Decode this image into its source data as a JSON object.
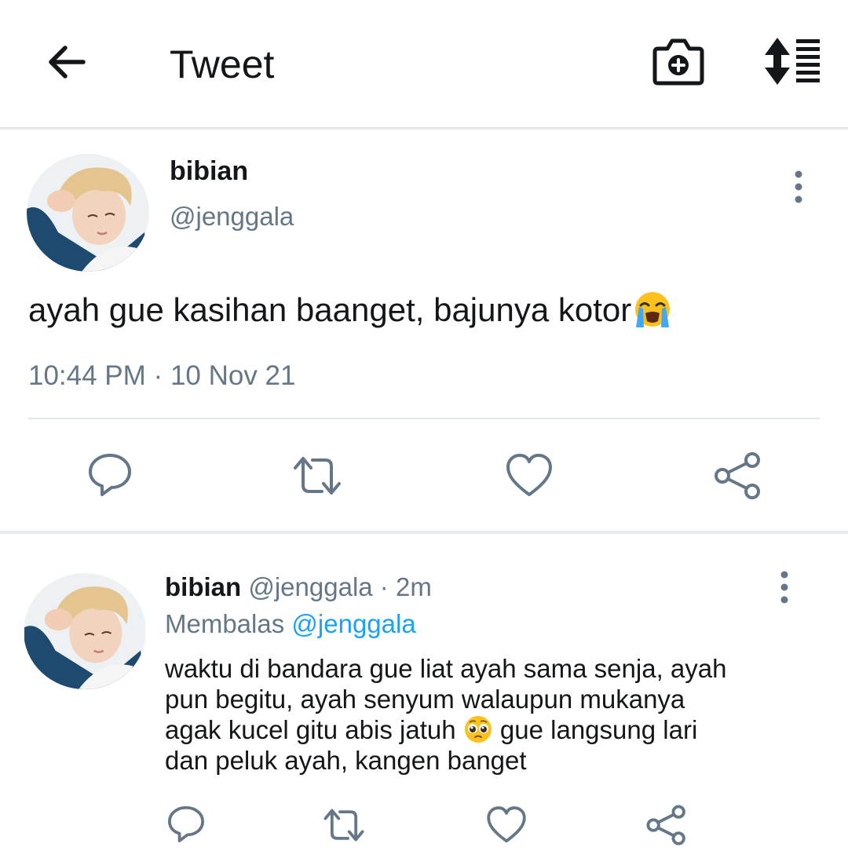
{
  "header": {
    "title": "Tweet",
    "back_icon": "arrow-left-icon",
    "camera_icon": "camera-plus-icon",
    "sort_icon": "sort-list-icon"
  },
  "main_tweet": {
    "author_name": "bibian",
    "author_handle": "@jenggala",
    "text": "ayah gue kasihan baanget, bajunya kotor",
    "emoji": "loudly-crying-face",
    "time": "10:44 PM",
    "separator": "·",
    "date": "10 Nov 21",
    "actions": [
      "reply-icon",
      "retweet-icon",
      "like-icon",
      "share-icon"
    ]
  },
  "reply": {
    "author_name": "bibian",
    "author_handle": "@jenggala",
    "separator": "·",
    "age": "2m",
    "replying_label": "Membalas",
    "replying_to": "@jenggala",
    "lines": [
      "waktu di bandara gue liat ayah sama senja, ayah",
      "pun begitu, ayah senyum walaupun mukanya",
      "agak kucel gitu abis jatuh",
      "gue langsung lari",
      "dan peluk ayah, kangen banget"
    ],
    "emoji": "pleading-face",
    "actions": [
      "reply-icon",
      "retweet-icon",
      "like-icon",
      "share-icon"
    ]
  },
  "colors": {
    "text_primary": "#14171a",
    "text_secondary": "#657786",
    "link": "#1da1f2",
    "icon": "#657786",
    "divider": "#e1e8ed"
  }
}
